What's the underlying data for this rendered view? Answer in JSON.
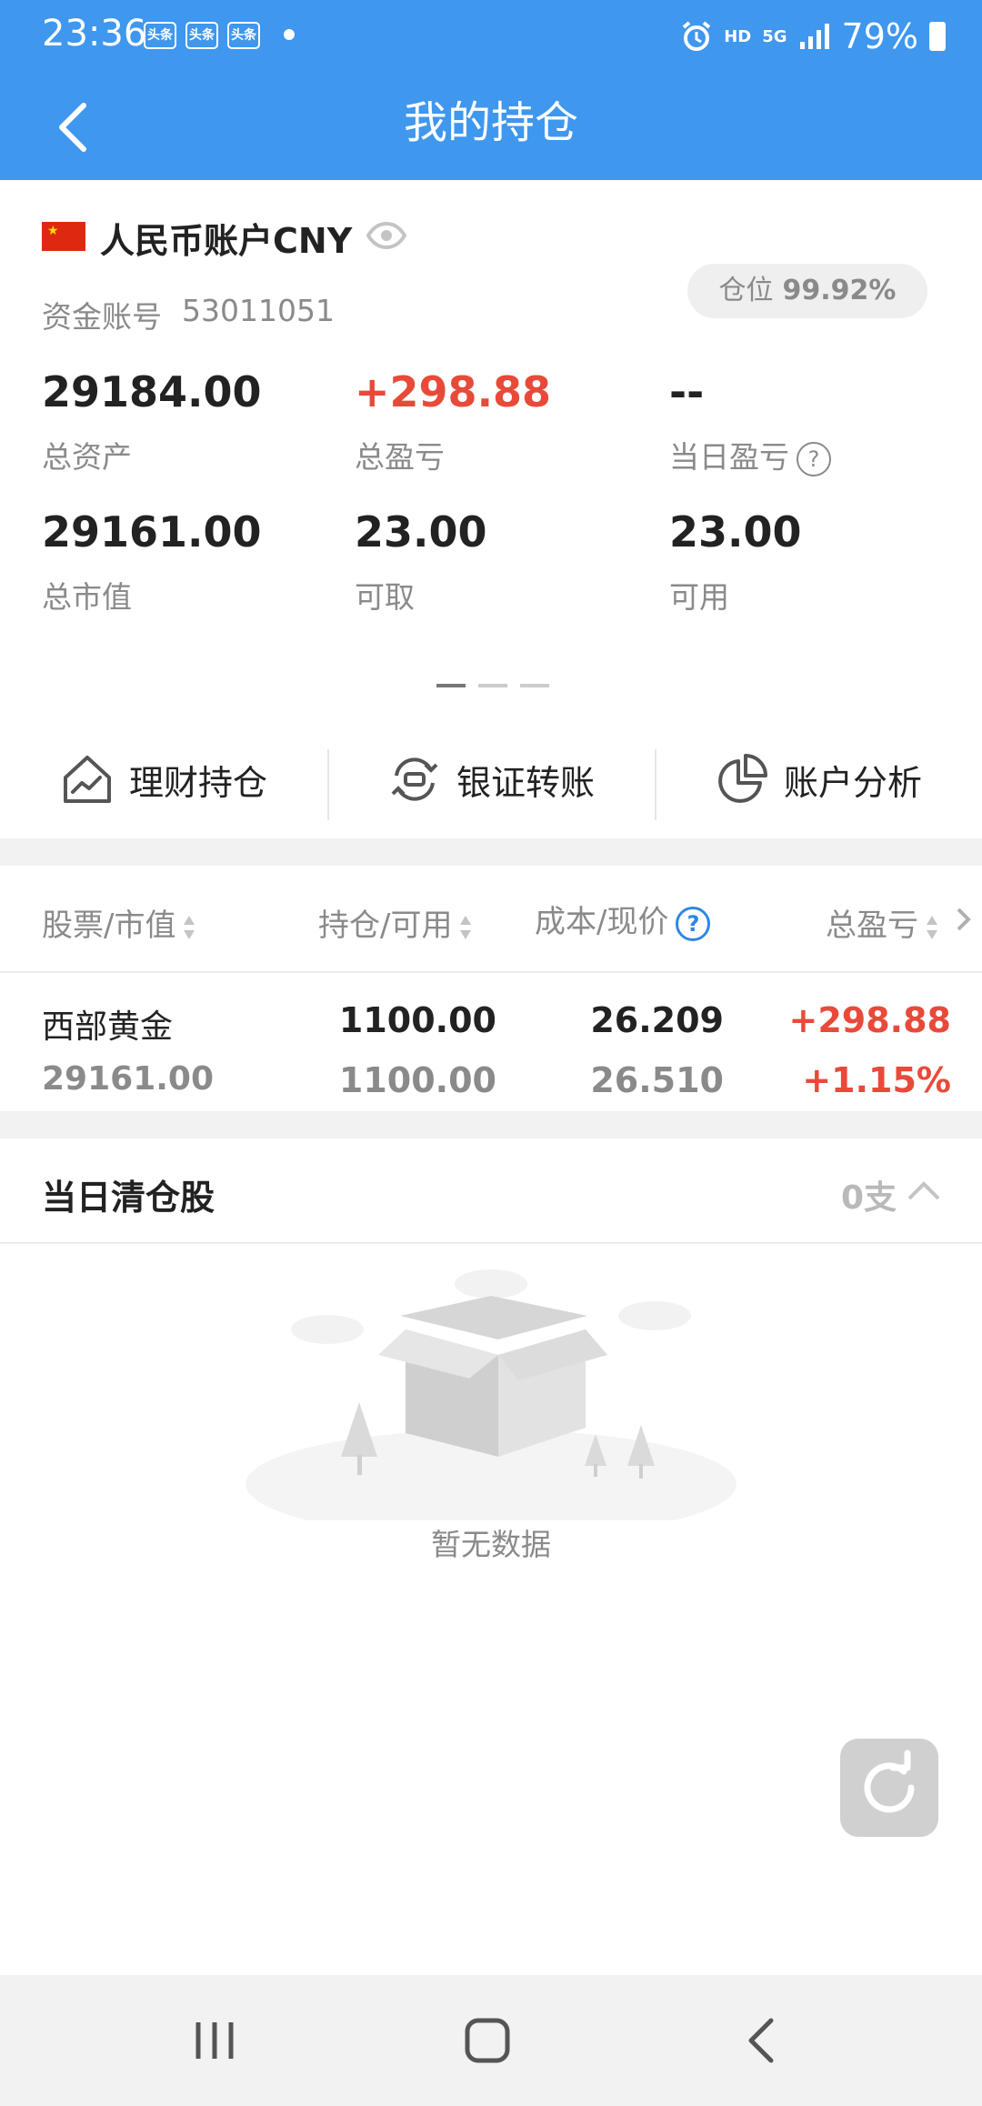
{
  "status_bar": {
    "time": "23:36",
    "news_badge": "头条",
    "hd": "HD",
    "network": "5G",
    "battery": "79%"
  },
  "header": {
    "title": "我的持仓"
  },
  "account": {
    "title": "人民币账户CNY",
    "account_no_label": "资金账号",
    "account_no": "53011051",
    "position_label": "仓位",
    "position_value": "99.92%",
    "metrics": {
      "total_assets": {
        "value": "29184.00",
        "label": "总资产"
      },
      "total_pl": {
        "value": "+298.88",
        "label": "总盈亏"
      },
      "daily_pl": {
        "value": "--",
        "label": "当日盈亏"
      },
      "market_value": {
        "value": "29161.00",
        "label": "总市值"
      },
      "withdrawable": {
        "value": "23.00",
        "label": "可取"
      },
      "available": {
        "value": "23.00",
        "label": "可用"
      }
    },
    "help_mark": "?"
  },
  "actions": [
    {
      "label": "理财持仓",
      "icon": "house-chart-icon"
    },
    {
      "label": "银证转账",
      "icon": "transfer-icon"
    },
    {
      "label": "账户分析",
      "icon": "pie-chart-icon"
    }
  ],
  "holdings": {
    "columns": [
      "股票/市值",
      "持仓/可用",
      "成本/现价",
      "总盈亏"
    ],
    "help_mark": "?",
    "rows": [
      {
        "name": "西部黄金",
        "market_value": "29161.00",
        "position": "1100.00",
        "available": "1100.00",
        "cost": "26.209",
        "price": "26.510",
        "pl": "+298.88",
        "pl_pct": "+1.15%"
      }
    ]
  },
  "cleared": {
    "title": "当日清仓股",
    "count": "0支",
    "empty_text": "暂无数据"
  },
  "colors": {
    "brand_blue": "#3f97ee",
    "gain_red": "#e84a3a",
    "help_blue": "#2f86e6"
  }
}
